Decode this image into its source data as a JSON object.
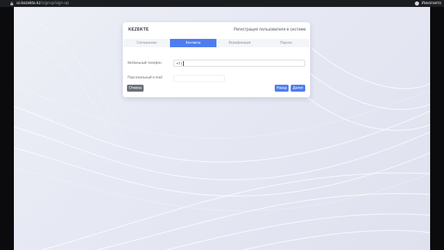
{
  "browser": {
    "url_host": "ui.kezekte.kz",
    "url_path": "/signup/sign-up",
    "profile_name": "Инкогнито"
  },
  "card": {
    "brand": "KEZEKTE",
    "subtitle": "Регистрация пользователя в системе",
    "tabs": [
      {
        "label": "Соглашение",
        "active": false
      },
      {
        "label": "Контакты",
        "active": true
      },
      {
        "label": "Верификация",
        "active": false
      },
      {
        "label": "Пароль",
        "active": false
      }
    ],
    "phone_label": "Мобильный телефон",
    "phone_value": "+7 (",
    "email_label": "Персональный e-mail",
    "cancel_label": "Отмена",
    "back_label": "Назад",
    "next_label": "Далее"
  },
  "colors": {
    "accent": "#4e7df0",
    "cancel": "#6c707a"
  }
}
